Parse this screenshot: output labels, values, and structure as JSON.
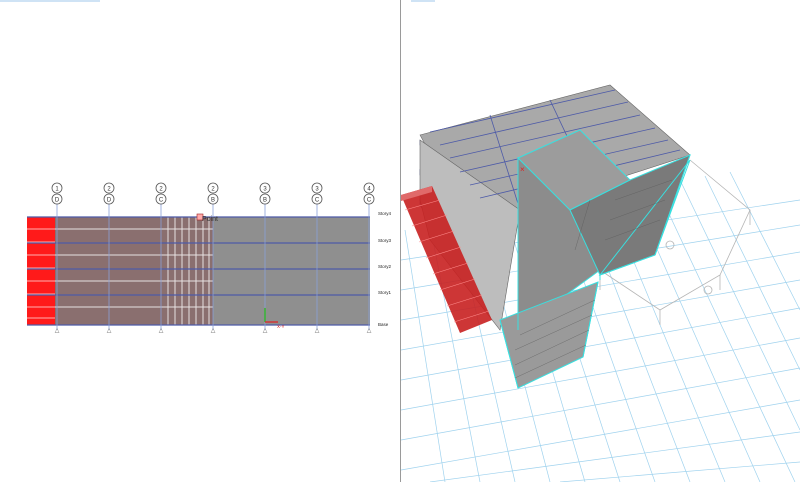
{
  "elevation_view": {
    "grid_bubbles": [
      {
        "top": "1",
        "bottom": "D"
      },
      {
        "top": "2",
        "bottom": "D"
      },
      {
        "top": "2",
        "bottom": "C"
      },
      {
        "top": "2",
        "bottom": "B"
      },
      {
        "top": "3",
        "bottom": "B"
      },
      {
        "top": "3",
        "bottom": "C"
      },
      {
        "top": "4",
        "bottom": "C"
      }
    ],
    "story_labels": [
      "Story4",
      "Story3",
      "Story2",
      "Story1",
      "Base"
    ],
    "cursor_tooltip": "Point",
    "axis_label": "X-Y",
    "colors": {
      "load_red": "#ff1a1a",
      "panel_gray": "#8f8f8f",
      "grid_line": "#4d5aa8",
      "highlight_cyan": "#3fd9d9"
    }
  },
  "model_3d_view": {
    "colors": {
      "ground_grid": "#9fd2ee",
      "slab": "#a9a9a9",
      "selection_edges": "#38e0e0",
      "load_red": "#c82020"
    }
  }
}
